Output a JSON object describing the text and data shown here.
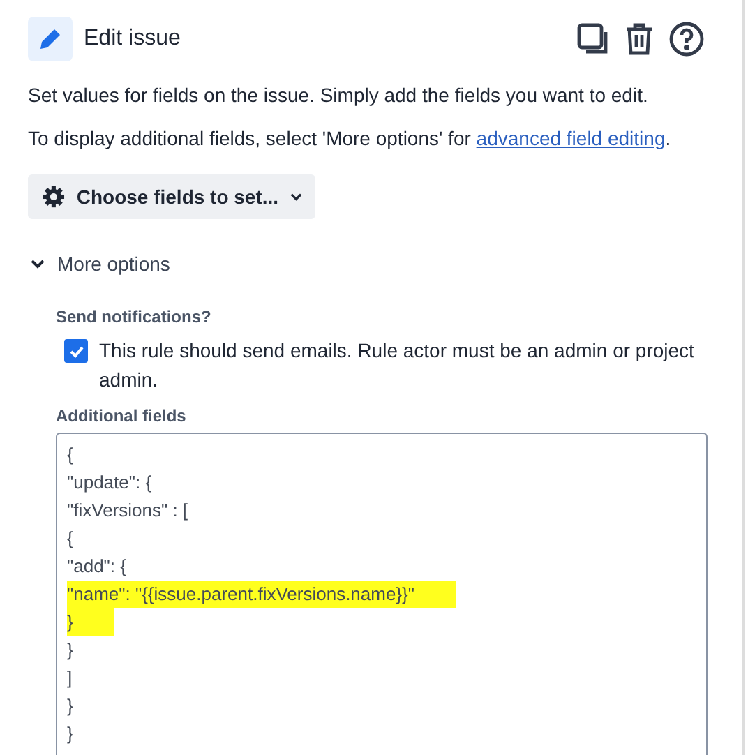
{
  "header": {
    "title": "Edit issue"
  },
  "description": "Set values for fields on the issue. Simply add the fields you want to edit.",
  "advanced_note": {
    "text": "To display additional fields, select 'More options' for ",
    "link": "advanced field editing",
    "after": "."
  },
  "choose_button": {
    "label": "Choose fields to set..."
  },
  "more_options": {
    "label": "More options",
    "expanded": true
  },
  "notifications": {
    "label": "Send notifications?",
    "checkbox_label": "This rule should send emails. Rule actor must be an admin or project admin.",
    "checked": true
  },
  "additional_fields": {
    "label": "Additional fields",
    "lines": [
      {
        "text": "{",
        "highlighted": false
      },
      {
        "text": "\"update\": {",
        "highlighted": false
      },
      {
        "text": "\"fixVersions\" : [",
        "highlighted": false
      },
      {
        "text": "{",
        "highlighted": false
      },
      {
        "text": "\"add\": {",
        "highlighted": false
      },
      {
        "text": "\"name\": \"{{issue.parent.fixVersions.name}}\"",
        "highlighted": true
      },
      {
        "text": "}",
        "highlighted": true
      },
      {
        "text": "}",
        "highlighted": false
      },
      {
        "text": "]",
        "highlighted": false
      },
      {
        "text": "}",
        "highlighted": false
      },
      {
        "text": "}",
        "highlighted": false
      }
    ]
  }
}
